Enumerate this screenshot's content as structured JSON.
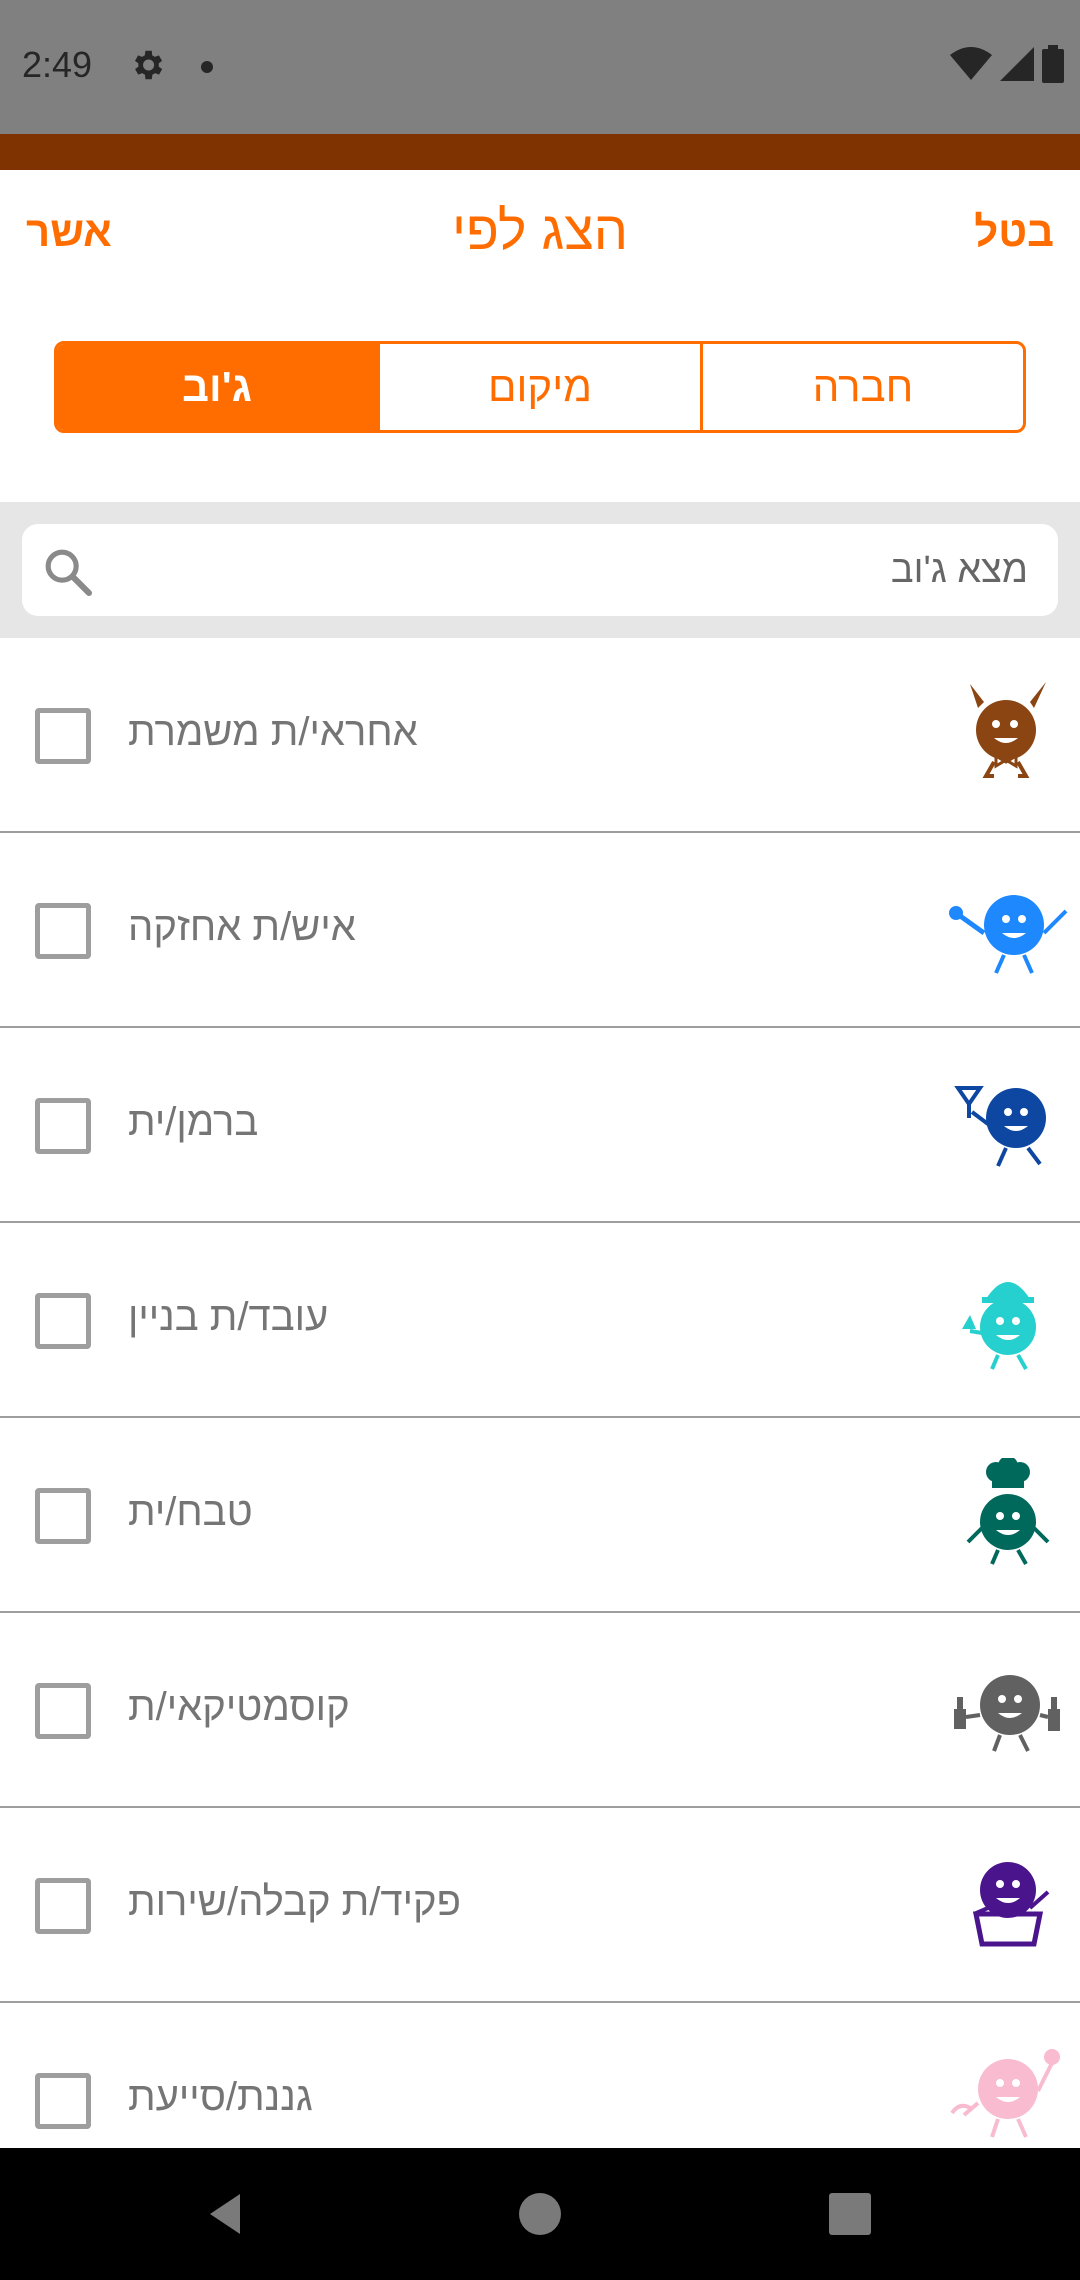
{
  "status_bar": {
    "time": "2:49",
    "icons": [
      "gear-icon",
      "notification-dot-icon",
      "wifi-icon",
      "signal-icon",
      "battery-icon"
    ]
  },
  "header": {
    "title": "הצג לפי",
    "confirm_label": "אשר",
    "cancel_label": "בטל"
  },
  "tabs": [
    {
      "label": "ג'וב",
      "active": true
    },
    {
      "label": "מיקום",
      "active": false
    },
    {
      "label": "חברה",
      "active": false
    }
  ],
  "search": {
    "placeholder": "מצא ג'וב",
    "value": ""
  },
  "jobs": [
    {
      "label": "אחראי/ת משמרת",
      "icon": "shift-manager-character-icon",
      "icon_color": "#8b4513",
      "checked": false
    },
    {
      "label": "איש/ת אחזקה",
      "icon": "maintenance-character-icon",
      "icon_color": "#1e88ff",
      "checked": false
    },
    {
      "label": "ברמן/ית",
      "icon": "bartender-character-icon",
      "icon_color": "#0d47a1",
      "checked": false
    },
    {
      "label": "עובד/ת בניין",
      "icon": "construction-worker-character-icon",
      "icon_color": "#26d0ce",
      "checked": false
    },
    {
      "label": "טבח/ית",
      "icon": "chef-character-icon",
      "icon_color": "#00695c",
      "checked": false
    },
    {
      "label": "קוסמטיקאי/ת",
      "icon": "cosmetician-character-icon",
      "icon_color": "#616161",
      "checked": false
    },
    {
      "label": "פקיד/ת קבלה/שירות",
      "icon": "receptionist-character-icon",
      "icon_color": "#4a148c",
      "checked": false
    },
    {
      "label": "גננת/סייעת",
      "icon": "kindergarten-teacher-character-icon",
      "icon_color": "#f8bbd0",
      "checked": false
    }
  ],
  "colors": {
    "accent": "#ff6d00",
    "brown_strip": "#7f3300",
    "status_bar": "#808080",
    "divider": "#9e9e9e",
    "text_muted": "#757575"
  },
  "nav_bar": {
    "icons": [
      "back-icon",
      "home-icon",
      "recents-icon"
    ]
  }
}
